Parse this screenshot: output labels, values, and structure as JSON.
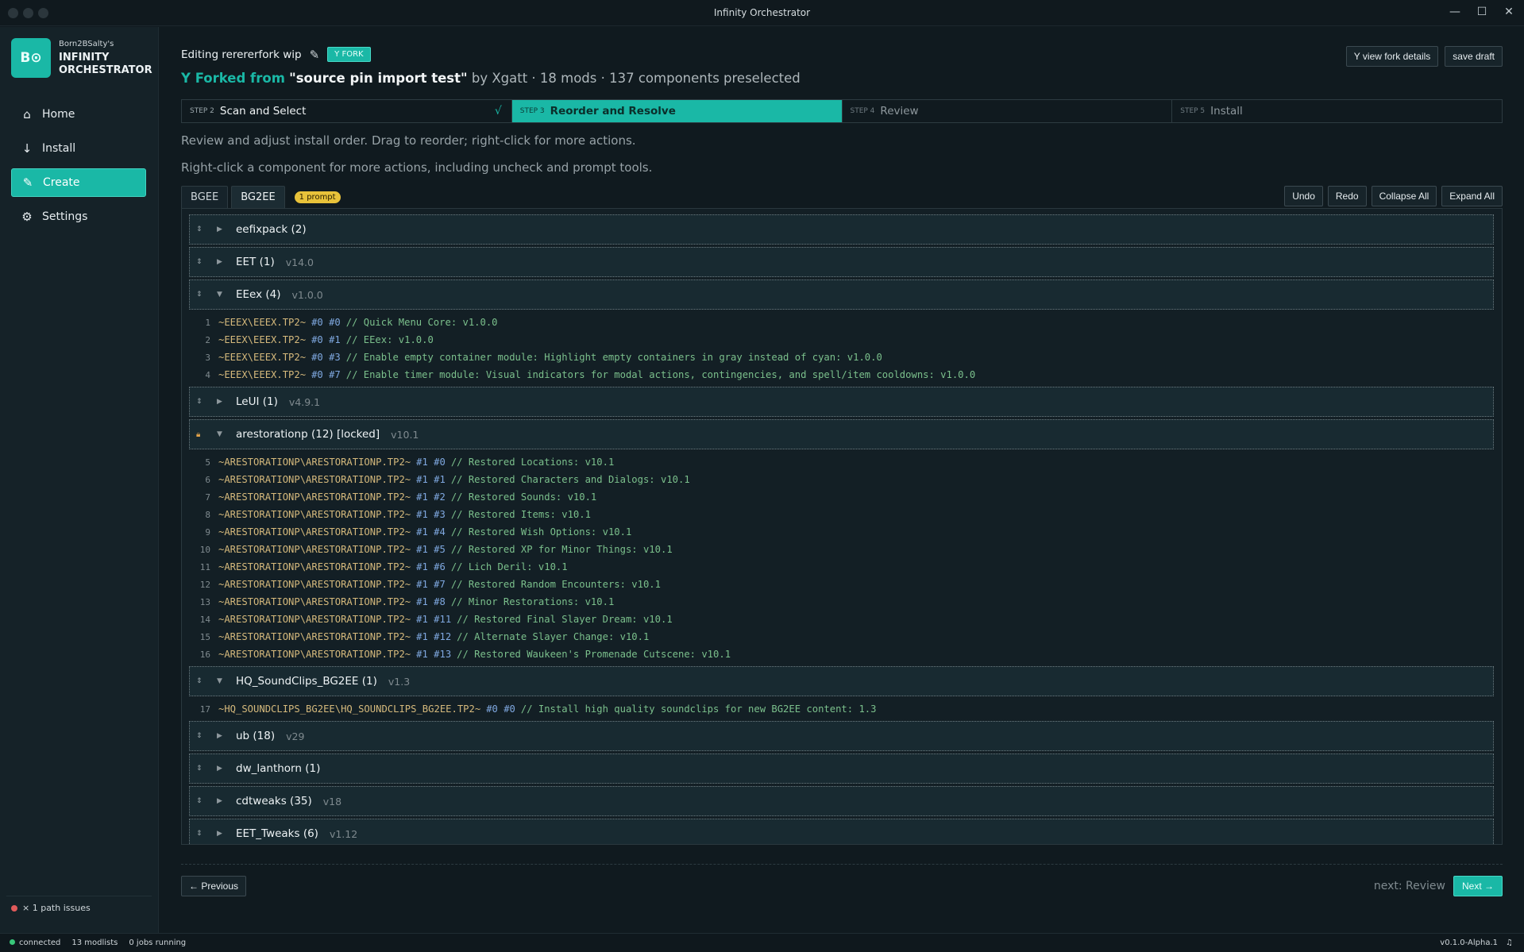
{
  "window": {
    "title": "Infinity Orchestrator",
    "controls": [
      "—",
      "☐",
      "✕"
    ]
  },
  "brand": {
    "user": "Born2BSalty's",
    "name_line1": "INFINITY",
    "name_line2": "ORCHESTRATOR",
    "logo_text": "B⊙"
  },
  "nav": {
    "home": "Home",
    "install": "Install",
    "create": "Create",
    "settings": "Settings"
  },
  "sidebar_status": {
    "path_issues": "× 1 path issues"
  },
  "statusbar": {
    "connected": "connected",
    "modlists": "13 modlists",
    "jobs": "0 jobs running",
    "version": "v0.1.0-Alpha.1",
    "bell": "♫"
  },
  "header": {
    "editing": "Editing rerererfork wip",
    "fork_badge": "Y FORK",
    "forked_from_label": "Y Forked from",
    "forked_source": "\"source pin import test\"",
    "forked_rest": " by Xgatt · 18 mods · 137 components preselected",
    "view_fork": "Y view fork details",
    "save_draft": "save draft"
  },
  "steps": [
    {
      "num": "STEP 2",
      "title": "Scan and Select",
      "state": "done",
      "check": "√"
    },
    {
      "num": "STEP 3",
      "title": "Reorder and Resolve",
      "state": "active"
    },
    {
      "num": "STEP 4",
      "title": "Review",
      "state": "future"
    },
    {
      "num": "STEP 5",
      "title": "Install",
      "state": "future"
    }
  ],
  "hints": {
    "line1": "Review and adjust install order. Drag to reorder; right-click for more actions.",
    "line2": "Right-click a component for more actions, including uncheck and prompt tools."
  },
  "tabs": {
    "bgee": "BGEE",
    "bg2ee": "BG2EE",
    "prompt_badge": "1 prompt"
  },
  "controls": {
    "undo": "Undo",
    "redo": "Redo",
    "collapse": "Collapse All",
    "expand": "Expand All"
  },
  "mods": [
    {
      "name": "eefixpack (2)",
      "version": "",
      "expanded": false,
      "locked": false,
      "components": []
    },
    {
      "name": "EET (1)",
      "version": "v14.0",
      "expanded": false,
      "locked": false,
      "components": []
    },
    {
      "name": "EEex (4)",
      "version": "v1.0.0",
      "expanded": true,
      "locked": false,
      "components": [
        {
          "n": "1",
          "path": "~EEEX\\EEEX.TP2~",
          "ids": "#0 #0",
          "desc": "// Quick Menu Core: v1.0.0"
        },
        {
          "n": "2",
          "path": "~EEEX\\EEEX.TP2~",
          "ids": "#0 #1",
          "desc": "// EEex: v1.0.0"
        },
        {
          "n": "3",
          "path": "~EEEX\\EEEX.TP2~",
          "ids": "#0 #3",
          "desc": "// Enable empty container module: Highlight empty containers in gray instead of cyan: v1.0.0"
        },
        {
          "n": "4",
          "path": "~EEEX\\EEEX.TP2~",
          "ids": "#0 #7",
          "desc": "// Enable timer module: Visual indicators for modal actions, contingencies, and spell/item cooldowns: v1.0.0"
        }
      ]
    },
    {
      "name": "LeUI (1)",
      "version": "v4.9.1",
      "expanded": false,
      "locked": false,
      "components": []
    },
    {
      "name": "arestorationp (12) [locked]",
      "version": "v10.1",
      "expanded": true,
      "locked": true,
      "components": [
        {
          "n": "5",
          "path": "~ARESTORATIONP\\ARESTORATIONP.TP2~",
          "ids": "#1 #0",
          "desc": "// Restored Locations: v10.1"
        },
        {
          "n": "6",
          "path": "~ARESTORATIONP\\ARESTORATIONP.TP2~",
          "ids": "#1 #1",
          "desc": "// Restored Characters and Dialogs: v10.1"
        },
        {
          "n": "7",
          "path": "~ARESTORATIONP\\ARESTORATIONP.TP2~",
          "ids": "#1 #2",
          "desc": "// Restored Sounds: v10.1"
        },
        {
          "n": "8",
          "path": "~ARESTORATIONP\\ARESTORATIONP.TP2~",
          "ids": "#1 #3",
          "desc": "// Restored Items: v10.1"
        },
        {
          "n": "9",
          "path": "~ARESTORATIONP\\ARESTORATIONP.TP2~",
          "ids": "#1 #4",
          "desc": "// Restored Wish Options: v10.1"
        },
        {
          "n": "10",
          "path": "~ARESTORATIONP\\ARESTORATIONP.TP2~",
          "ids": "#1 #5",
          "desc": "// Restored XP for Minor Things: v10.1"
        },
        {
          "n": "11",
          "path": "~ARESTORATIONP\\ARESTORATIONP.TP2~",
          "ids": "#1 #6",
          "desc": "// Lich Deril: v10.1"
        },
        {
          "n": "12",
          "path": "~ARESTORATIONP\\ARESTORATIONP.TP2~",
          "ids": "#1 #7",
          "desc": "// Restored Random Encounters: v10.1"
        },
        {
          "n": "13",
          "path": "~ARESTORATIONP\\ARESTORATIONP.TP2~",
          "ids": "#1 #8",
          "desc": "// Minor Restorations: v10.1"
        },
        {
          "n": "14",
          "path": "~ARESTORATIONP\\ARESTORATIONP.TP2~",
          "ids": "#1 #11",
          "desc": "// Restored Final Slayer Dream: v10.1"
        },
        {
          "n": "15",
          "path": "~ARESTORATIONP\\ARESTORATIONP.TP2~",
          "ids": "#1 #12",
          "desc": "// Alternate Slayer Change: v10.1"
        },
        {
          "n": "16",
          "path": "~ARESTORATIONP\\ARESTORATIONP.TP2~",
          "ids": "#1 #13",
          "desc": "// Restored Waukeen's Promenade Cutscene: v10.1"
        }
      ]
    },
    {
      "name": "HQ_SoundClips_BG2EE (1)",
      "version": "v1.3",
      "expanded": true,
      "locked": false,
      "components": [
        {
          "n": "17",
          "path": "~HQ_SOUNDCLIPS_BG2EE\\HQ_SOUNDCLIPS_BG2EE.TP2~",
          "ids": "#0 #0",
          "desc": "// Install high quality soundclips for new BG2EE content: 1.3"
        }
      ]
    },
    {
      "name": "ub (18)",
      "version": "v29",
      "expanded": false,
      "locked": false,
      "components": []
    },
    {
      "name": "dw_lanthorn (1)",
      "version": "",
      "expanded": false,
      "locked": false,
      "components": []
    },
    {
      "name": "cdtweaks (35)",
      "version": "v18",
      "expanded": false,
      "locked": false,
      "components": []
    },
    {
      "name": "EET_Tweaks (6)",
      "version": "v1.12",
      "expanded": false,
      "locked": false,
      "components": []
    }
  ],
  "footer": {
    "previous": "← Previous",
    "next_label": "next: Review",
    "next": "Next →"
  },
  "colors": {
    "accent": "#1ab8a6",
    "prompt_badge": "#e8c23a",
    "path_text": "#d5b97c",
    "ids_text": "#7fa8e0",
    "desc_text": "#7bc08c"
  }
}
